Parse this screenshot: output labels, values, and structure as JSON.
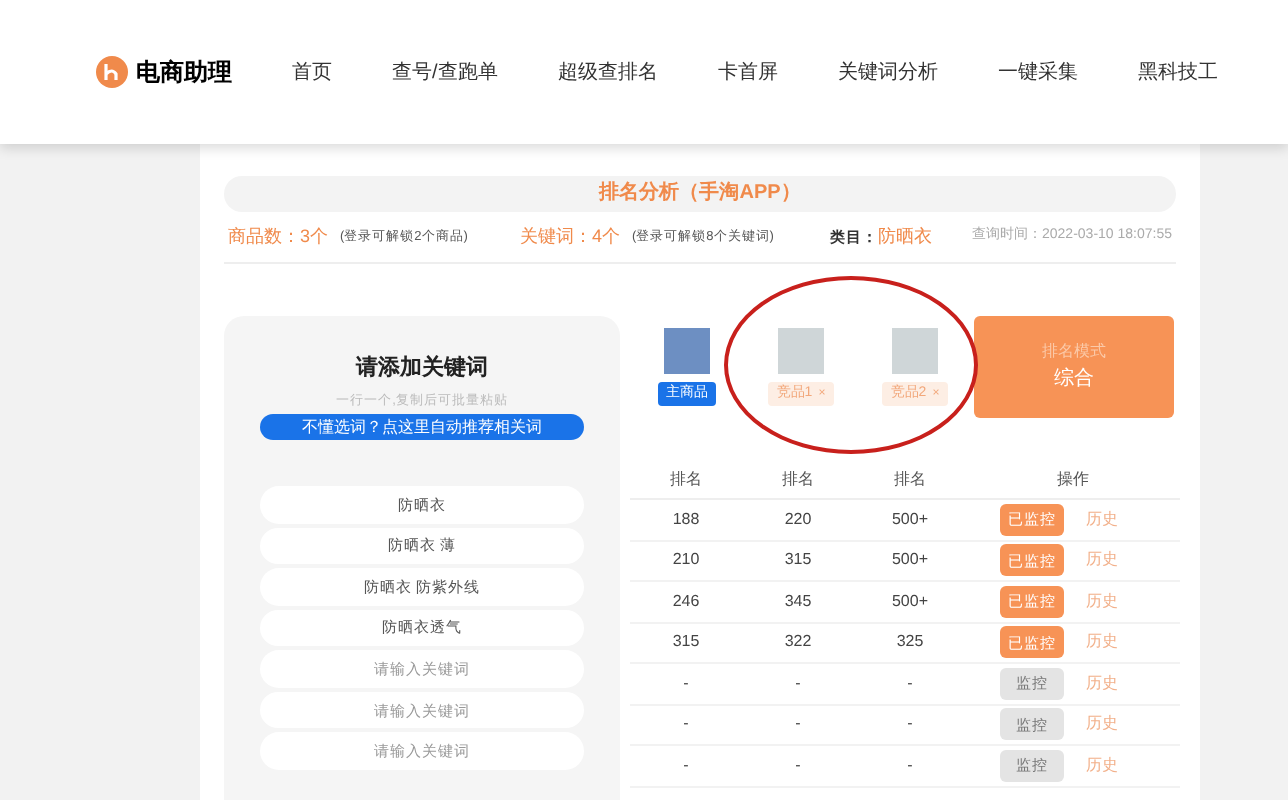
{
  "nav": {
    "logo": "电商助理",
    "items": [
      "首页",
      "查号/查跑单",
      "超级查排名",
      "卡首屏",
      "关键词分析",
      "一键采集",
      "黑科技工"
    ]
  },
  "title": "排名分析（手淘APP）",
  "info": {
    "goods_label": "商品数：",
    "goods_count": "3个",
    "goods_hint": "(登录可解锁2个商品)",
    "kw_label": "关键词：",
    "kw_count": "4个",
    "kw_hint": "(登录可解锁8个关键词)",
    "category_label": "类目：",
    "category": "防晒衣",
    "time": "查询时间：2022-03-10 18:07:55"
  },
  "keyword_panel": {
    "title": "请添加关键词",
    "subtitle": "一行一个,复制后可批量粘贴",
    "recommend_button": "不懂选词？点这里自动推荐相关词",
    "keywords": [
      {
        "value": "防晒衣"
      },
      {
        "value": "防晒衣 薄"
      },
      {
        "value": "防晒衣 防紫外线"
      },
      {
        "value": "防晒衣透气"
      },
      {
        "placeholder": "请输入关键词"
      },
      {
        "placeholder": "请输入关键词"
      },
      {
        "placeholder": "请输入关键词"
      }
    ]
  },
  "products": [
    {
      "kind": "main",
      "tag": "主商品"
    },
    {
      "kind": "competitor",
      "tag": "竞品1",
      "remove": "×"
    },
    {
      "kind": "competitor",
      "tag": "竞品2",
      "remove": "×"
    }
  ],
  "mode": {
    "label": "排名模式",
    "value": "综合"
  },
  "table": {
    "columns": [
      "排名",
      "排名",
      "排名",
      "操作"
    ],
    "rows": [
      {
        "ranks": [
          "188",
          "220",
          "500+"
        ],
        "monitored": true,
        "action": "已监控",
        "history": "历史"
      },
      {
        "ranks": [
          "210",
          "315",
          "500+"
        ],
        "monitored": true,
        "action": "已监控",
        "history": "历史"
      },
      {
        "ranks": [
          "246",
          "345",
          "500+"
        ],
        "monitored": true,
        "action": "已监控",
        "history": "历史"
      },
      {
        "ranks": [
          "315",
          "322",
          "325"
        ],
        "monitored": true,
        "action": "已监控",
        "history": "历史"
      },
      {
        "ranks": [
          "-",
          "-",
          "-"
        ],
        "monitored": false,
        "action": "监控",
        "history": "历史"
      },
      {
        "ranks": [
          "-",
          "-",
          "-"
        ],
        "monitored": false,
        "action": "监控",
        "history": "历史"
      },
      {
        "ranks": [
          "-",
          "-",
          "-"
        ],
        "monitored": false,
        "action": "监控",
        "history": "历史"
      }
    ]
  }
}
